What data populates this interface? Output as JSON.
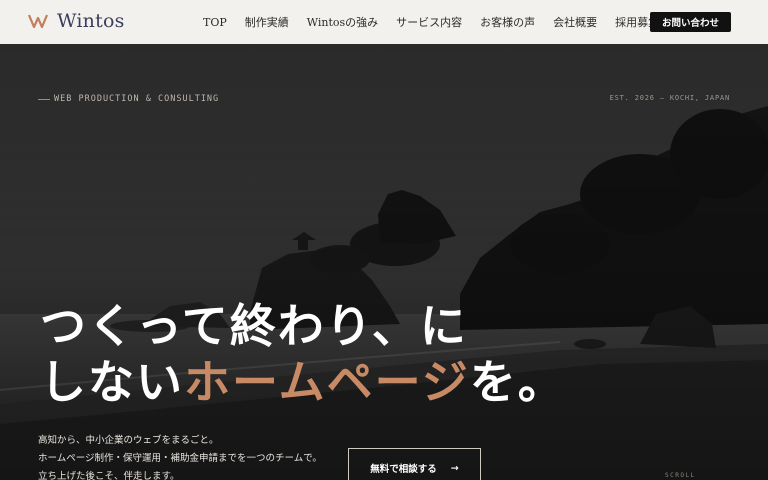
{
  "header": {
    "logo_text_main": "W",
    "logo_text_rest": "intos",
    "nav": [
      {
        "label": "TOP"
      },
      {
        "label": "制作実績"
      },
      {
        "label": "Wintosの強み"
      },
      {
        "label": "サービス内容"
      },
      {
        "label": "お客様の声"
      },
      {
        "label": "会社概要"
      },
      {
        "label": "採用募集"
      }
    ],
    "cta_label": "お問い合わせ"
  },
  "hero": {
    "eyebrow": "WEB PRODUCTION & CONSULTING",
    "est": "EST. 2026 — KOCHI, JAPAN",
    "headline_line1": "つくって終わり、に",
    "headline_line2_pre": "しない",
    "headline_line2_highlight": "ホームページ",
    "headline_line2_post": "を。",
    "lead": [
      "高知から、中小企業のウェブをまるごと。",
      "ホームページ制作・保守運用・補助金申請までを一つのチームで。",
      "立ち上げた後こそ、伴走します。"
    ],
    "consult_label": "無料で相談する",
    "consult_arrow": "→",
    "scroll_label": "SCROLL"
  },
  "colors": {
    "accent": "#c17f5a",
    "navy": "#3a3d5c",
    "header_bg": "#f3f1ed"
  }
}
